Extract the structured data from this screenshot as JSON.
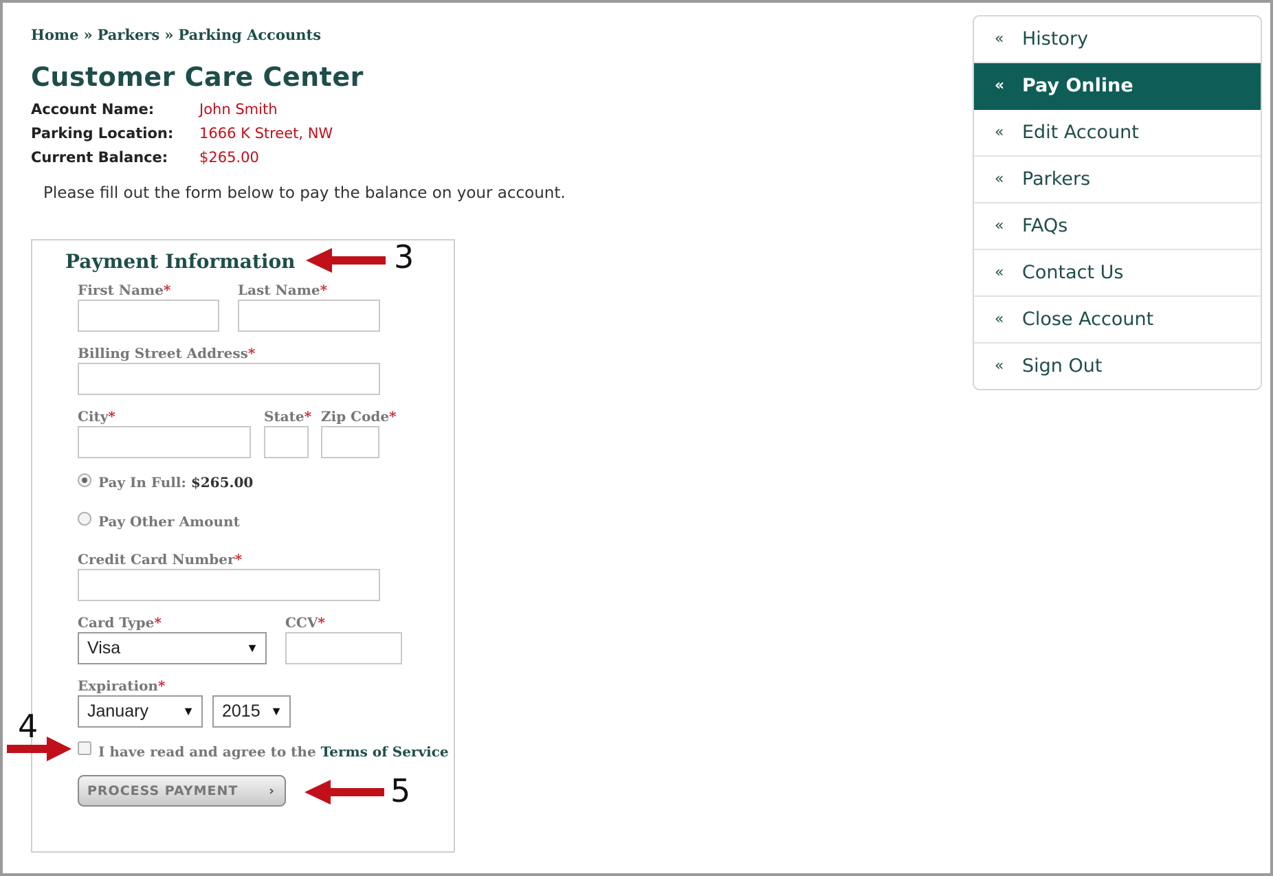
{
  "breadcrumb": {
    "items": [
      "Home",
      "Parkers",
      "Parking Accounts"
    ],
    "separator": "»"
  },
  "page_title": "Customer Care Center",
  "account": {
    "name_label": "Account Name:",
    "name_value": "John Smith",
    "location_label": "Parking Location:",
    "location_value": "1666 K Street, NW",
    "balance_label": "Current Balance:",
    "balance_value": "$265.00"
  },
  "intro_text": "Please fill out the form below to pay the balance on your account.",
  "form": {
    "title": "Payment Information",
    "required_mark": "*",
    "first_name_label": "First Name",
    "last_name_label": "Last Name",
    "street_label": "Billing Street Address",
    "city_label": "City",
    "state_label": "State",
    "zip_label": "Zip Code",
    "pay_full_label": "Pay In Full:",
    "pay_full_amount": "$265.00",
    "pay_other_label": "Pay Other Amount",
    "card_number_label": "Credit Card Number",
    "card_type_label": "Card Type",
    "card_type_value": "Visa",
    "ccv_label": "CCV",
    "expiration_label": "Expiration",
    "exp_month_value": "January",
    "exp_year_value": "2015",
    "tos_prefix": "I have read and agree to the ",
    "tos_link": "Terms of Service",
    "submit_label": "PROCESS PAYMENT",
    "submit_chevron": "›",
    "dropdown_arrow": "▼"
  },
  "annotations": {
    "step3": "3",
    "step4": "4",
    "step5": "5"
  },
  "sidebar": {
    "chevron": "«",
    "items": [
      {
        "label": "History",
        "active": false
      },
      {
        "label": "Pay Online",
        "active": true
      },
      {
        "label": "Edit Account",
        "active": false
      },
      {
        "label": "Parkers",
        "active": false
      },
      {
        "label": "FAQs",
        "active": false
      },
      {
        "label": "Contact Us",
        "active": false
      },
      {
        "label": "Close Account",
        "active": false
      },
      {
        "label": "Sign Out",
        "active": false
      }
    ]
  },
  "colors": {
    "brand": "#1f4e4a",
    "active_nav": "#0e5d57",
    "value_red": "#c0101a",
    "annotation_arrow": "#c0101a"
  }
}
